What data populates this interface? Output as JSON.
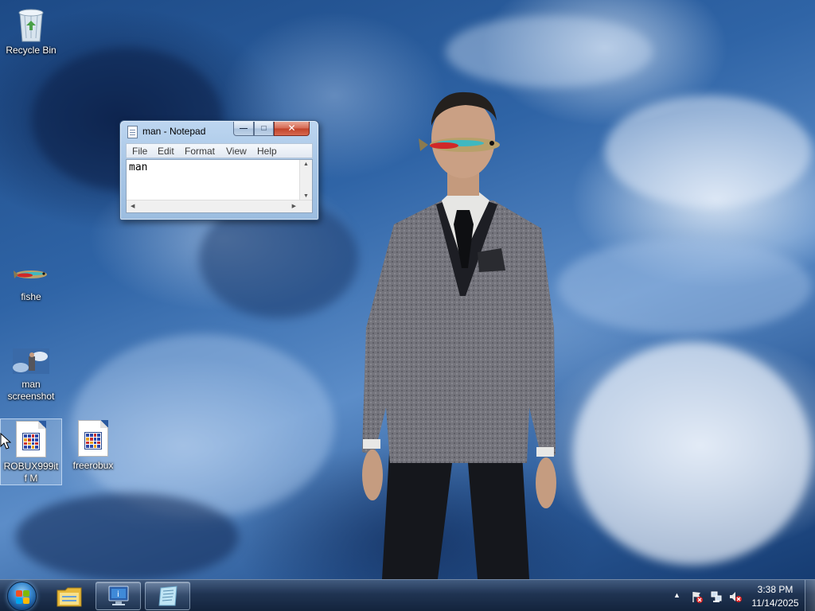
{
  "desktop": {
    "icons": [
      {
        "label": "Recycle Bin",
        "icon": "recycle-bin-icon"
      },
      {
        "label": "fishe",
        "icon": "fish-image-icon"
      },
      {
        "label": "man screenshot",
        "icon": "image-thumbnail-icon"
      },
      {
        "label": "ROBUX999itf M",
        "icon": "document-icon",
        "selected": true
      },
      {
        "label": "freerobux",
        "icon": "document-icon"
      }
    ]
  },
  "notepad": {
    "title": "man - Notepad",
    "controls": {
      "minimize": "—",
      "maximize": "□",
      "close": "✕"
    },
    "menu": [
      "File",
      "Edit",
      "Format",
      "View",
      "Help"
    ],
    "content": "man"
  },
  "taskbar": {
    "start_icon": "windows-start-orb",
    "pinned": [
      {
        "name": "Windows Explorer",
        "icon": "folder-icon",
        "state": "pinned"
      },
      {
        "name": "Computer",
        "icon": "monitor-icon",
        "state": "running"
      },
      {
        "name": "Notepad",
        "icon": "notepad-icon",
        "state": "running"
      }
    ],
    "tray": {
      "icons": [
        "show-hidden-icons-arrow",
        "action-center-flag-icon",
        "network-icon",
        "volume-muted-icon"
      ],
      "time": "3:38 PM",
      "date": "11/14/2025"
    }
  },
  "colors": {
    "taskbar": "#1f3352",
    "notepad_frame": "#a8c6e6",
    "close_button": "#c8452d"
  }
}
